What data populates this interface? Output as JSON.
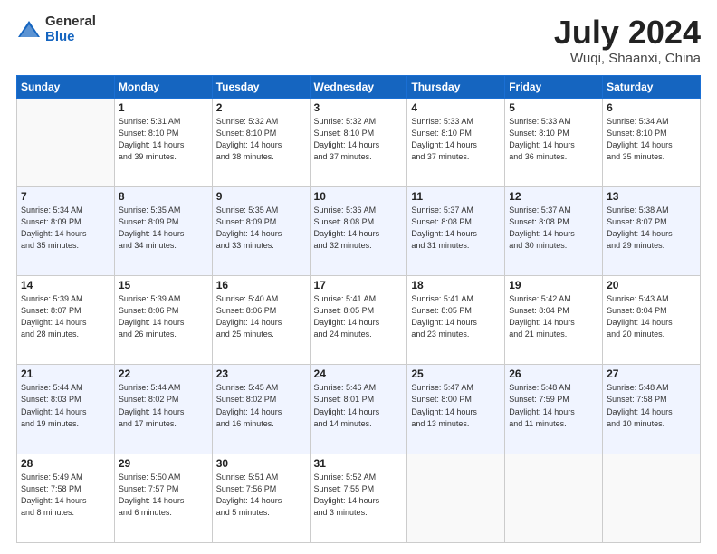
{
  "logo": {
    "general": "General",
    "blue": "Blue"
  },
  "title": {
    "month": "July 2024",
    "location": "Wuqi, Shaanxi, China"
  },
  "days_header": [
    "Sunday",
    "Monday",
    "Tuesday",
    "Wednesday",
    "Thursday",
    "Friday",
    "Saturday"
  ],
  "weeks": [
    [
      {
        "num": "",
        "info": ""
      },
      {
        "num": "1",
        "info": "Sunrise: 5:31 AM\nSunset: 8:10 PM\nDaylight: 14 hours\nand 39 minutes."
      },
      {
        "num": "2",
        "info": "Sunrise: 5:32 AM\nSunset: 8:10 PM\nDaylight: 14 hours\nand 38 minutes."
      },
      {
        "num": "3",
        "info": "Sunrise: 5:32 AM\nSunset: 8:10 PM\nDaylight: 14 hours\nand 37 minutes."
      },
      {
        "num": "4",
        "info": "Sunrise: 5:33 AM\nSunset: 8:10 PM\nDaylight: 14 hours\nand 37 minutes."
      },
      {
        "num": "5",
        "info": "Sunrise: 5:33 AM\nSunset: 8:10 PM\nDaylight: 14 hours\nand 36 minutes."
      },
      {
        "num": "6",
        "info": "Sunrise: 5:34 AM\nSunset: 8:10 PM\nDaylight: 14 hours\nand 35 minutes."
      }
    ],
    [
      {
        "num": "7",
        "info": "Sunrise: 5:34 AM\nSunset: 8:09 PM\nDaylight: 14 hours\nand 35 minutes."
      },
      {
        "num": "8",
        "info": "Sunrise: 5:35 AM\nSunset: 8:09 PM\nDaylight: 14 hours\nand 34 minutes."
      },
      {
        "num": "9",
        "info": "Sunrise: 5:35 AM\nSunset: 8:09 PM\nDaylight: 14 hours\nand 33 minutes."
      },
      {
        "num": "10",
        "info": "Sunrise: 5:36 AM\nSunset: 8:08 PM\nDaylight: 14 hours\nand 32 minutes."
      },
      {
        "num": "11",
        "info": "Sunrise: 5:37 AM\nSunset: 8:08 PM\nDaylight: 14 hours\nand 31 minutes."
      },
      {
        "num": "12",
        "info": "Sunrise: 5:37 AM\nSunset: 8:08 PM\nDaylight: 14 hours\nand 30 minutes."
      },
      {
        "num": "13",
        "info": "Sunrise: 5:38 AM\nSunset: 8:07 PM\nDaylight: 14 hours\nand 29 minutes."
      }
    ],
    [
      {
        "num": "14",
        "info": "Sunrise: 5:39 AM\nSunset: 8:07 PM\nDaylight: 14 hours\nand 28 minutes."
      },
      {
        "num": "15",
        "info": "Sunrise: 5:39 AM\nSunset: 8:06 PM\nDaylight: 14 hours\nand 26 minutes."
      },
      {
        "num": "16",
        "info": "Sunrise: 5:40 AM\nSunset: 8:06 PM\nDaylight: 14 hours\nand 25 minutes."
      },
      {
        "num": "17",
        "info": "Sunrise: 5:41 AM\nSunset: 8:05 PM\nDaylight: 14 hours\nand 24 minutes."
      },
      {
        "num": "18",
        "info": "Sunrise: 5:41 AM\nSunset: 8:05 PM\nDaylight: 14 hours\nand 23 minutes."
      },
      {
        "num": "19",
        "info": "Sunrise: 5:42 AM\nSunset: 8:04 PM\nDaylight: 14 hours\nand 21 minutes."
      },
      {
        "num": "20",
        "info": "Sunrise: 5:43 AM\nSunset: 8:04 PM\nDaylight: 14 hours\nand 20 minutes."
      }
    ],
    [
      {
        "num": "21",
        "info": "Sunrise: 5:44 AM\nSunset: 8:03 PM\nDaylight: 14 hours\nand 19 minutes."
      },
      {
        "num": "22",
        "info": "Sunrise: 5:44 AM\nSunset: 8:02 PM\nDaylight: 14 hours\nand 17 minutes."
      },
      {
        "num": "23",
        "info": "Sunrise: 5:45 AM\nSunset: 8:02 PM\nDaylight: 14 hours\nand 16 minutes."
      },
      {
        "num": "24",
        "info": "Sunrise: 5:46 AM\nSunset: 8:01 PM\nDaylight: 14 hours\nand 14 minutes."
      },
      {
        "num": "25",
        "info": "Sunrise: 5:47 AM\nSunset: 8:00 PM\nDaylight: 14 hours\nand 13 minutes."
      },
      {
        "num": "26",
        "info": "Sunrise: 5:48 AM\nSunset: 7:59 PM\nDaylight: 14 hours\nand 11 minutes."
      },
      {
        "num": "27",
        "info": "Sunrise: 5:48 AM\nSunset: 7:58 PM\nDaylight: 14 hours\nand 10 minutes."
      }
    ],
    [
      {
        "num": "28",
        "info": "Sunrise: 5:49 AM\nSunset: 7:58 PM\nDaylight: 14 hours\nand 8 minutes."
      },
      {
        "num": "29",
        "info": "Sunrise: 5:50 AM\nSunset: 7:57 PM\nDaylight: 14 hours\nand 6 minutes."
      },
      {
        "num": "30",
        "info": "Sunrise: 5:51 AM\nSunset: 7:56 PM\nDaylight: 14 hours\nand 5 minutes."
      },
      {
        "num": "31",
        "info": "Sunrise: 5:52 AM\nSunset: 7:55 PM\nDaylight: 14 hours\nand 3 minutes."
      },
      {
        "num": "",
        "info": ""
      },
      {
        "num": "",
        "info": ""
      },
      {
        "num": "",
        "info": ""
      }
    ]
  ]
}
